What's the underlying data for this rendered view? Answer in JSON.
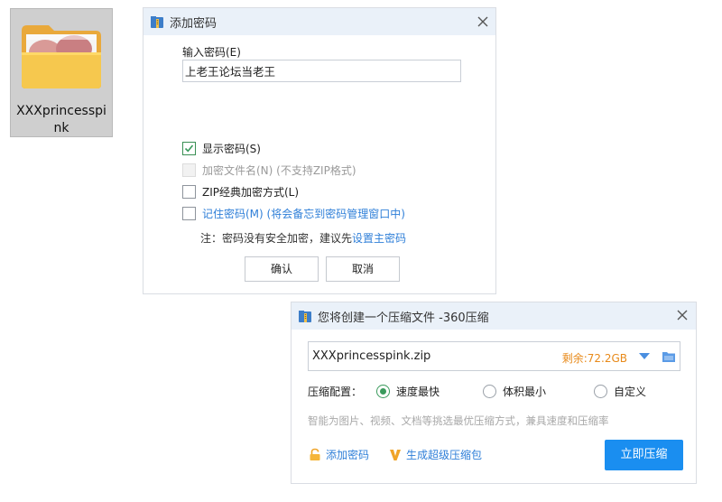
{
  "desktop": {
    "folder_label": "XXXprincesspink"
  },
  "password_dialog": {
    "title": "添加密码",
    "input_label": "输入密码(E)",
    "password_value": "上老王论坛当老王",
    "show_password": {
      "label": "显示密码(S)",
      "checked": true
    },
    "encrypt_filenames": {
      "label": "加密文件名(N) (不支持ZIP格式)",
      "disabled": true
    },
    "zip_classic": {
      "label": "ZIP经典加密方式(L)",
      "checked": false
    },
    "remember_password": {
      "label": "记住密码(M) (将会备忘到密码管理窗口中)",
      "checked": false
    },
    "note_text": "注：密码没有安全加密，建议先",
    "note_link": "设置主密码",
    "ok_label": "确认",
    "cancel_label": "取消"
  },
  "compress_dialog": {
    "title": "您将创建一个压缩文件 -360压缩",
    "filename": "XXXprincesspink.zip",
    "free_space": "剩余:72.2GB",
    "config_label": "压缩配置：",
    "options": [
      {
        "label": "速度最快",
        "selected": true
      },
      {
        "label": "体积最小",
        "selected": false
      },
      {
        "label": "自定义",
        "selected": false
      }
    ],
    "hint": "智能为图片、视频、文档等挑选最优压缩方式，兼具速度和压缩率",
    "add_password_label": "添加密码",
    "super_package_label": "生成超级压缩包",
    "compress_now_label": "立即压缩"
  },
  "colors": {
    "accent_blue": "#1a8ef0",
    "check_green": "#3a9a5c",
    "free_space_orange": "#e88a1a",
    "titlebar_bg": "#eaf1f9"
  }
}
